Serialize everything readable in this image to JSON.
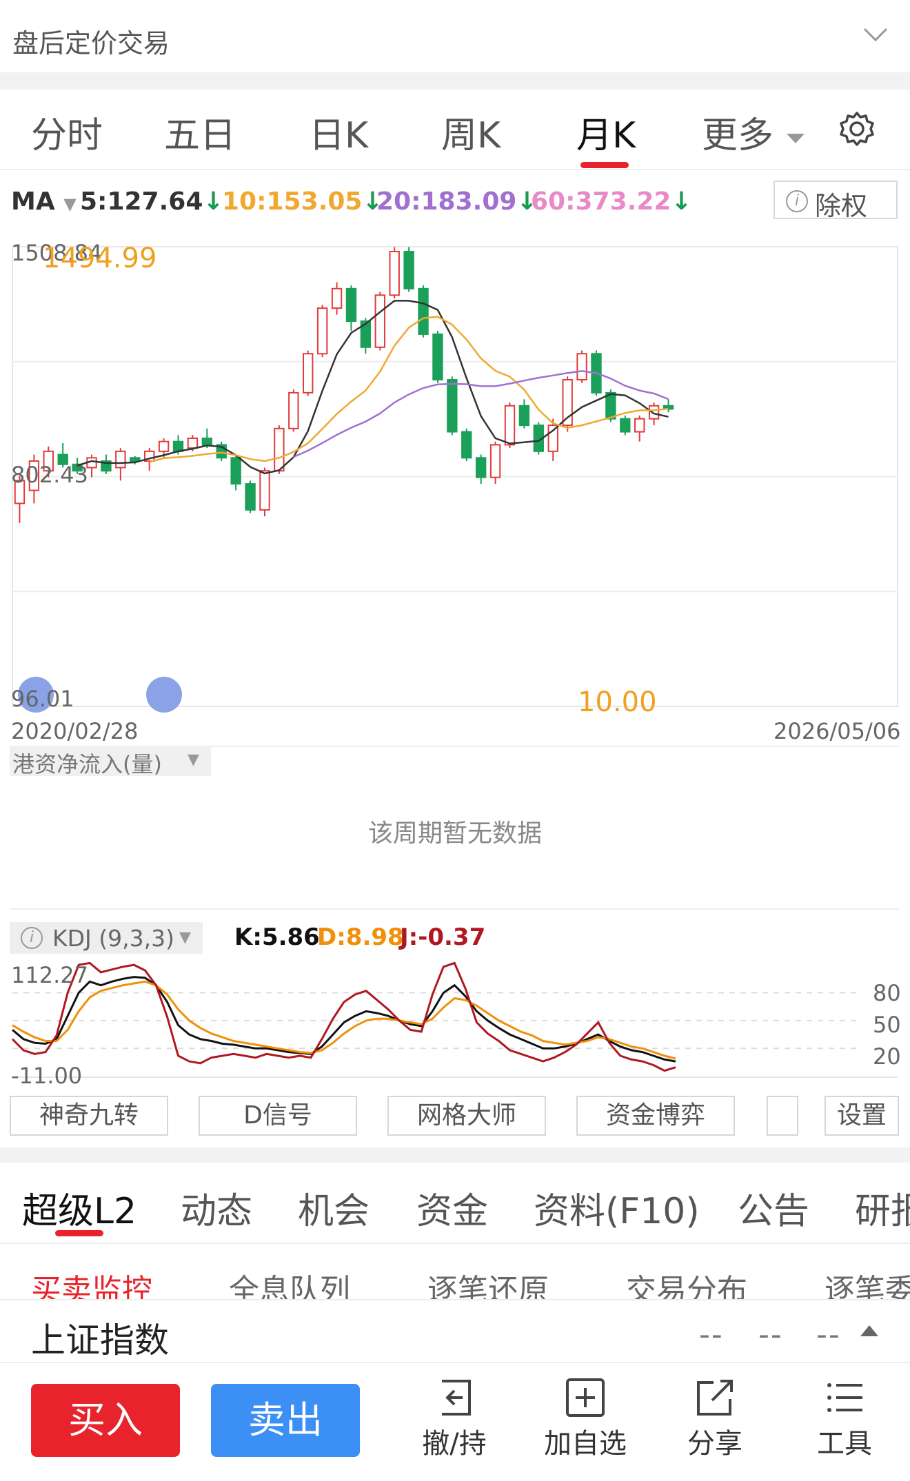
{
  "header": {
    "title": "盘后定价交易"
  },
  "tabs": [
    {
      "label": "分时",
      "active": false
    },
    {
      "label": "五日",
      "active": false
    },
    {
      "label": "日K",
      "active": false
    },
    {
      "label": "周K",
      "active": false
    },
    {
      "label": "月K",
      "active": true
    },
    {
      "label": "更多",
      "active": false
    }
  ],
  "ma": {
    "label": "MA",
    "ma5": "5:127.64",
    "ma10": "10:153.05",
    "ma20": "20:183.09",
    "ma60": "60:373.22",
    "colors": {
      "ma5": "#333333",
      "ma10": "#f0a830",
      "ma20": "#a070d0",
      "ma60": "#e88ac8"
    },
    "exright_label": "除权"
  },
  "chart_data": [
    {
      "type": "candlestick",
      "y_top_label": "1508.84",
      "y_mid_label": "802.43",
      "y_bottom_label": "96.01",
      "max_annotation": "1494.99",
      "min_annotation": "10.00",
      "x_start": "2020/02/28",
      "x_end": "2026/05/06",
      "ylim": [
        96.01,
        1508.84
      ],
      "candles": [
        [
          720,
          790,
          660,
          805
        ],
        [
          760,
          850,
          720,
          870
        ],
        [
          820,
          880,
          800,
          895
        ],
        [
          870,
          840,
          830,
          905
        ],
        [
          840,
          820,
          810,
          860
        ],
        [
          830,
          860,
          800,
          870
        ],
        [
          850,
          820,
          810,
          870
        ],
        [
          830,
          880,
          790,
          890
        ],
        [
          860,
          850,
          840,
          865
        ],
        [
          850,
          880,
          820,
          890
        ],
        [
          880,
          910,
          860,
          920
        ],
        [
          910,
          880,
          870,
          930
        ],
        [
          890,
          920,
          880,
          930
        ],
        [
          920,
          900,
          890,
          950
        ],
        [
          900,
          860,
          850,
          910
        ],
        [
          860,
          780,
          760,
          870
        ],
        [
          780,
          700,
          690,
          790
        ],
        [
          700,
          820,
          680,
          830
        ],
        [
          820,
          950,
          810,
          960
        ],
        [
          950,
          1060,
          940,
          1070
        ],
        [
          1060,
          1180,
          1050,
          1190
        ],
        [
          1180,
          1320,
          1170,
          1330
        ],
        [
          1320,
          1380,
          1300,
          1400
        ],
        [
          1380,
          1280,
          1250,
          1390
        ],
        [
          1280,
          1200,
          1180,
          1290
        ],
        [
          1200,
          1360,
          1190,
          1370
        ],
        [
          1360,
          1494,
          1350,
          1508
        ],
        [
          1494,
          1380,
          1370,
          1508
        ],
        [
          1380,
          1240,
          1230,
          1390
        ],
        [
          1240,
          1100,
          1090,
          1250
        ],
        [
          1100,
          940,
          930,
          1110
        ],
        [
          940,
          860,
          850,
          950
        ],
        [
          860,
          800,
          780,
          870
        ],
        [
          800,
          900,
          780,
          910
        ],
        [
          900,
          1020,
          890,
          1030
        ],
        [
          1020,
          960,
          950,
          1040
        ],
        [
          960,
          880,
          870,
          970
        ],
        [
          880,
          960,
          850,
          980
        ],
        [
          960,
          1100,
          940,
          1110
        ],
        [
          1100,
          1180,
          1090,
          1190
        ],
        [
          1180,
          1060,
          1050,
          1190
        ],
        [
          1060,
          980,
          970,
          1070
        ],
        [
          980,
          940,
          930,
          990
        ],
        [
          940,
          980,
          910,
          990
        ],
        [
          980,
          1020,
          960,
          1030
        ],
        [
          1020,
          1010,
          1000,
          1040
        ]
      ]
    },
    {
      "type": "line",
      "indicator": "KDJ (9,3,3)",
      "k_label": "K:5.86",
      "d_label": "D:8.98",
      "j_label": "J:-0.37",
      "y_top_label": "112.27",
      "y_bottom_label": "-11.00",
      "right_ticks": [
        "80",
        "50",
        "20"
      ],
      "ylim": [
        -11.0,
        112.27
      ],
      "series": [
        {
          "name": "K",
          "color": "#111111",
          "values": [
            40,
            30,
            26,
            25,
            30,
            55,
            80,
            92,
            88,
            92,
            95,
            97,
            96,
            88,
            70,
            45,
            35,
            30,
            28,
            25,
            24,
            22,
            20,
            20,
            18,
            16,
            15,
            14,
            22,
            35,
            48,
            55,
            60,
            58,
            55,
            50,
            46,
            44,
            60,
            80,
            88,
            76,
            60,
            50,
            42,
            35,
            30,
            25,
            20,
            20,
            22,
            25,
            30,
            35,
            28,
            22,
            18,
            16,
            12,
            8,
            6
          ]
        },
        {
          "name": "D",
          "color": "#f0900a",
          "values": [
            45,
            38,
            32,
            28,
            28,
            40,
            60,
            75,
            82,
            85,
            88,
            90,
            92,
            88,
            78,
            62,
            50,
            42,
            36,
            32,
            28,
            26,
            24,
            22,
            20,
            18,
            16,
            15,
            18,
            26,
            36,
            44,
            50,
            52,
            52,
            50,
            48,
            46,
            52,
            64,
            74,
            72,
            66,
            58,
            50,
            44,
            38,
            34,
            28,
            26,
            24,
            26,
            28,
            32,
            30,
            26,
            22,
            20,
            16,
            12,
            9
          ]
        },
        {
          "name": "J",
          "color": "#b01820",
          "values": [
            30,
            18,
            14,
            16,
            34,
            80,
            110,
            112,
            102,
            105,
            108,
            110,
            104,
            88,
            54,
            12,
            6,
            4,
            10,
            12,
            14,
            12,
            10,
            14,
            12,
            10,
            12,
            10,
            30,
            52,
            70,
            78,
            82,
            72,
            62,
            50,
            40,
            38,
            78,
            108,
            112,
            84,
            48,
            36,
            28,
            18,
            14,
            10,
            6,
            10,
            16,
            24,
            36,
            48,
            26,
            12,
            8,
            6,
            2,
            -4,
            -0.37
          ]
        }
      ]
    }
  ],
  "flow_selector": {
    "label": "港资净流入(量)"
  },
  "no_data_text": "该周期暂无数据",
  "tools": [
    "神奇九转",
    "D信号",
    "网格大师",
    "资金博弈",
    "设置"
  ],
  "sub_tabs": [
    {
      "label": "超级L2",
      "active": true
    },
    {
      "label": "动态",
      "active": false
    },
    {
      "label": "机会",
      "active": false
    },
    {
      "label": "资金",
      "active": false
    },
    {
      "label": "资料(F10)",
      "active": false
    },
    {
      "label": "公告",
      "active": false
    },
    {
      "label": "研报",
      "active": false
    }
  ],
  "level2_tabs": [
    {
      "label": "买卖监控",
      "active": true
    },
    {
      "label": "全息队列",
      "active": false
    },
    {
      "label": "逐笔还原",
      "active": false
    },
    {
      "label": "交易分布",
      "active": false
    },
    {
      "label": "逐笔委",
      "active": false
    }
  ],
  "ticker": {
    "name": "上证指数",
    "dash1": "--",
    "dash2": "--",
    "dash3": "--"
  },
  "bottom": {
    "buy": "买入",
    "sell": "卖出",
    "items": [
      "撤/持",
      "加自选",
      "分享",
      "工具"
    ]
  }
}
